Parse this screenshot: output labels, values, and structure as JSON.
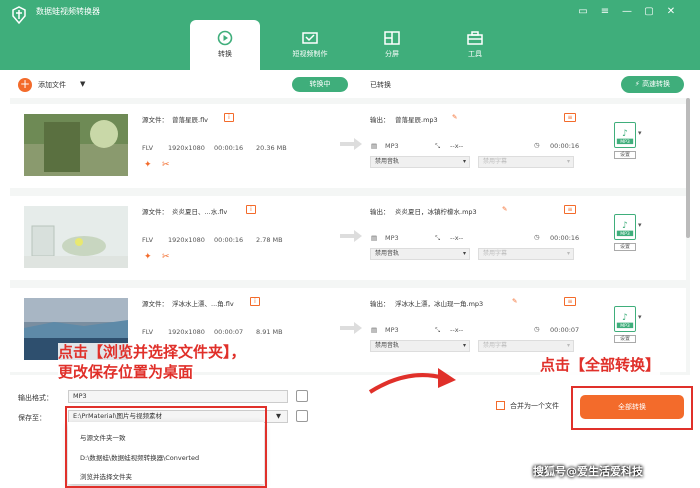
{
  "app": {
    "title": "数据蛙视频转换器"
  },
  "tabs": [
    {
      "label": "转换",
      "icon": "convert-icon",
      "active": true
    },
    {
      "label": "短视频制作",
      "icon": "video-icon",
      "active": false
    },
    {
      "label": "分屏",
      "icon": "split-icon",
      "active": false
    },
    {
      "label": "工具",
      "icon": "toolbox-icon",
      "active": false
    }
  ],
  "toolbar": {
    "add_file": "添加文件",
    "converting": "转换中",
    "converted": "已转换",
    "fast_convert": "高速转换"
  },
  "labels": {
    "source": "源文件：",
    "output": "输出：",
    "settings": "设置"
  },
  "files": [
    {
      "source": "曾落星辰.flv",
      "format": "FLV",
      "resolution": "1920x1080",
      "duration": "00:00:16",
      "size": "20.36 MB",
      "output_name": "曾落星辰.mp3",
      "out_format": "MP3",
      "out_res": "--x--",
      "out_duration": "00:00:16",
      "audio": "禁用音轨",
      "subtitle": "禁用字幕",
      "out_icon_label": "MP3"
    },
    {
      "source": "炎炎夏日、...水.flv",
      "format": "FLV",
      "resolution": "1920x1080",
      "duration": "00:00:16",
      "size": "2.78 MB",
      "output_name": "炎炎夏日，冰镇柠檬水.mp3",
      "out_format": "MP3",
      "out_res": "--x--",
      "out_duration": "00:00:16",
      "audio": "禁用音轨",
      "subtitle": "禁用字幕",
      "out_icon_label": "MP3"
    },
    {
      "source": "浮冰水上漂、...角.flv",
      "format": "FLV",
      "resolution": "1920x1080",
      "duration": "00:00:07",
      "size": "8.91 MB",
      "output_name": "浮冰水上漂，冰山现一角.mp3",
      "out_format": "MP3",
      "out_res": "--x--",
      "out_duration": "00:00:07",
      "audio": "禁用音轨",
      "subtitle": "禁用字幕",
      "out_icon_label": "MP3"
    }
  ],
  "bottom": {
    "output_format_label": "输出格式：",
    "output_format_value": "MP3",
    "save_to_label": "保存至：",
    "save_to_value": "E:\\PrMaterial\\图片与视频素材",
    "merge_label": "合并为一个文件",
    "convert_all": "全部转换"
  },
  "dropdown": {
    "options": [
      "与源文件夹一致",
      "D:\\数据蛙\\数据蛙视频转换器\\Converted",
      "浏览并选择文件夹"
    ]
  },
  "annotations": {
    "left_line1": "点击【浏览并选择文件夹】，",
    "left_line2": "更改保存位置为桌面",
    "right": "点击【全部转换】"
  },
  "watermark": "搜狐号@爱生活爱科技",
  "colors": {
    "brand_green": "#3fae7b",
    "accent_orange": "#f36b2b",
    "annotation_red": "#e0302a"
  }
}
